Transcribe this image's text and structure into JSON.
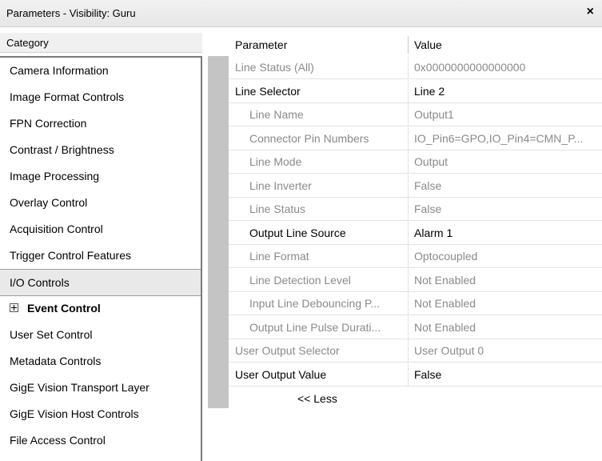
{
  "window": {
    "title": "Parameters - Visibility: Guru",
    "close_glyph": "×"
  },
  "category_panel": {
    "header": "Category",
    "items": [
      {
        "label": "Camera Information"
      },
      {
        "label": "Image Format Controls"
      },
      {
        "label": "FPN Correction"
      },
      {
        "label": "Contrast / Brightness"
      },
      {
        "label": "Image Processing"
      },
      {
        "label": "Overlay Control"
      },
      {
        "label": "Acquisition Control"
      },
      {
        "label": "Trigger Control Features"
      },
      {
        "label": "I/O Controls",
        "selected": true
      },
      {
        "label": "Event Control",
        "expandable": true
      },
      {
        "label": "User Set Control"
      },
      {
        "label": "Metadata Controls"
      },
      {
        "label": "GigE Vision Transport Layer"
      },
      {
        "label": "GigE Vision Host Controls"
      },
      {
        "label": "File Access Control"
      }
    ]
  },
  "parameter_panel": {
    "col_parameter": "Parameter",
    "col_value": "Value",
    "rows": [
      {
        "name": "Line Status (All)",
        "value": "0x0000000000000000",
        "indent": 0,
        "editable": false
      },
      {
        "name": "Line Selector",
        "value": "Line 2",
        "indent": 0,
        "editable": true
      },
      {
        "name": "Line Name",
        "value": "Output1",
        "indent": 1,
        "editable": false
      },
      {
        "name": "Connector Pin Numbers",
        "value": "IO_Pin6=GPO,IO_Pin4=CMN_P...",
        "indent": 1,
        "editable": false
      },
      {
        "name": "Line Mode",
        "value": "Output",
        "indent": 1,
        "editable": false
      },
      {
        "name": "Line Inverter",
        "value": "False",
        "indent": 1,
        "editable": false
      },
      {
        "name": "Line Status",
        "value": "False",
        "indent": 1,
        "editable": false
      },
      {
        "name": "Output Line Source",
        "value": "Alarm 1",
        "indent": 1,
        "editable": true
      },
      {
        "name": "Line Format",
        "value": "Optocoupled",
        "indent": 1,
        "editable": false
      },
      {
        "name": "Line Detection Level",
        "value": "Not Enabled",
        "indent": 1,
        "editable": false
      },
      {
        "name": "Input Line Debouncing P...",
        "value": "Not Enabled",
        "indent": 1,
        "editable": false
      },
      {
        "name": "Output Line Pulse Durati...",
        "value": "Not Enabled",
        "indent": 1,
        "editable": false
      },
      {
        "name": "User Output Selector",
        "value": "User Output 0",
        "indent": 0,
        "editable": false
      },
      {
        "name": "User Output Value",
        "value": "False",
        "indent": 0,
        "editable": true
      }
    ],
    "less_link": "<< Less"
  }
}
